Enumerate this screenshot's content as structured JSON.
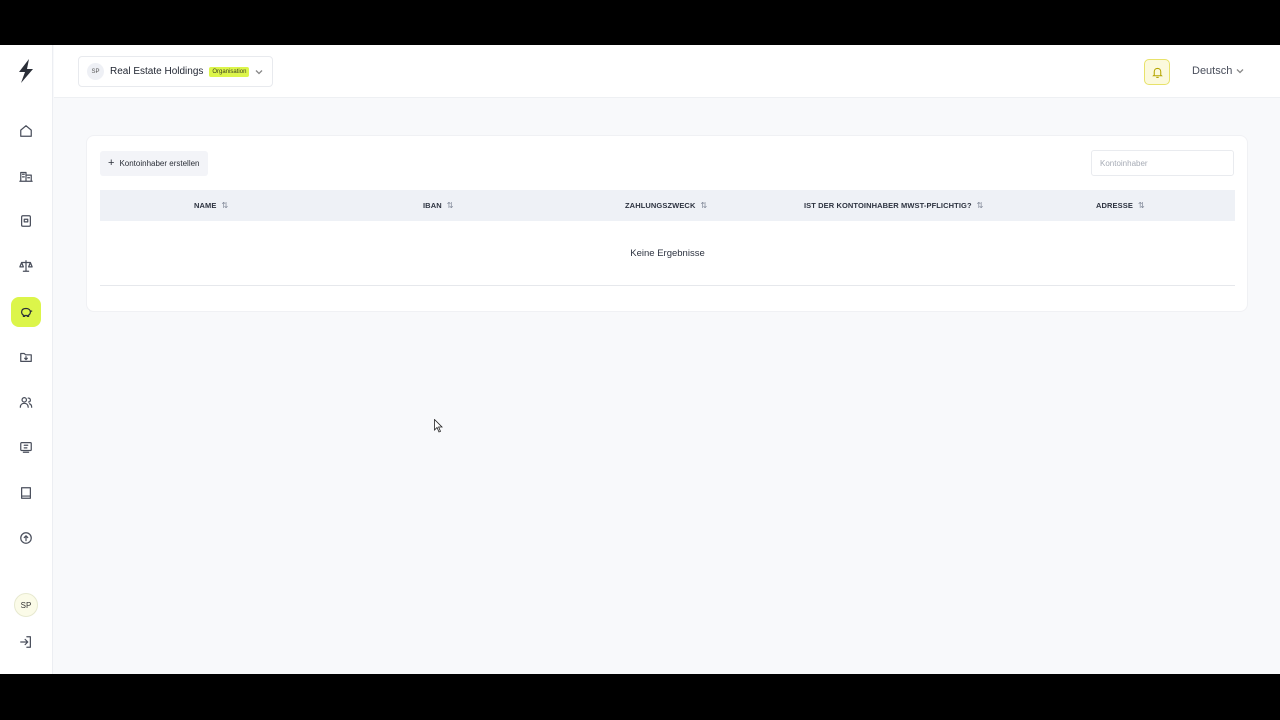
{
  "sidebar": {
    "logo_icon": "bolt-logo-icon",
    "items": [
      {
        "name": "home",
        "icon": "home-icon"
      },
      {
        "name": "buildings",
        "icon": "buildings-icon"
      },
      {
        "name": "documents",
        "icon": "document-icon"
      },
      {
        "name": "balance",
        "icon": "scale-icon"
      },
      {
        "name": "payments",
        "icon": "piggybank-icon",
        "active": true
      },
      {
        "name": "folders",
        "icon": "folder-icon"
      },
      {
        "name": "contacts",
        "icon": "users-icon"
      },
      {
        "name": "billing",
        "icon": "receipt-icon"
      },
      {
        "name": "book",
        "icon": "book-icon"
      },
      {
        "name": "upload",
        "icon": "upload-icon"
      }
    ],
    "user_initials": "SP",
    "logout_icon": "logout-icon"
  },
  "topbar": {
    "org_initials": "SP",
    "org_name": "Real Estate Holdings",
    "org_badge": "Organisation",
    "language": "Deutsch",
    "accent_color": "#dcf54a"
  },
  "toolbar": {
    "create_label": "Kontoinhaber erstellen",
    "search_placeholder": "Kontoinhaber"
  },
  "table": {
    "columns": [
      "NAME",
      "IBAN",
      "ZAHLUNGSZWECK",
      "IST DER KONTOINHABER MWST-PFLICHTIG?",
      "ADRESSE"
    ],
    "sort_glyph": "⇅",
    "empty_text": "Keine Ergebnisse"
  }
}
